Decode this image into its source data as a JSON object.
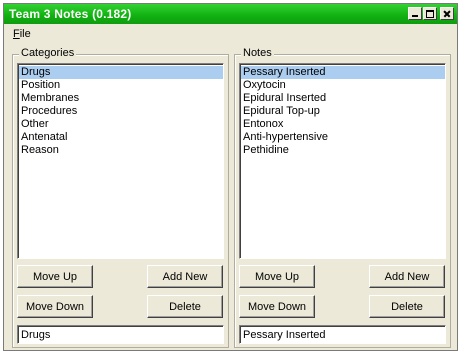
{
  "window": {
    "title": "Team 3 Notes (0.182)"
  },
  "menu": {
    "file_prefix": "",
    "file_accel": "F",
    "file_rest": "ile"
  },
  "categories": {
    "label": "Categories",
    "items": [
      "Drugs",
      "Position",
      "Membranes",
      "Procedures",
      "Other",
      "Antenatal",
      "Reason"
    ],
    "selected_index": 0,
    "move_up": "Move Up",
    "add_new": "Add New",
    "move_down": "Move Down",
    "delete": "Delete",
    "input_value": "Drugs"
  },
  "notes": {
    "label": "Notes",
    "items": [
      "Pessary Inserted",
      "Oxytocin",
      "Epidural Inserted",
      "Epidural Top-up",
      "Entonox",
      "Anti-hypertensive",
      "Pethidine"
    ],
    "selected_index": 0,
    "move_up": "Move Up",
    "add_new": "Add New",
    "move_down": "Move Down",
    "delete": "Delete",
    "input_value": "Pessary Inserted"
  },
  "colors": {
    "titlebar": "#11b311",
    "window_face": "#ece9d8",
    "selection": "#aacdf0"
  }
}
